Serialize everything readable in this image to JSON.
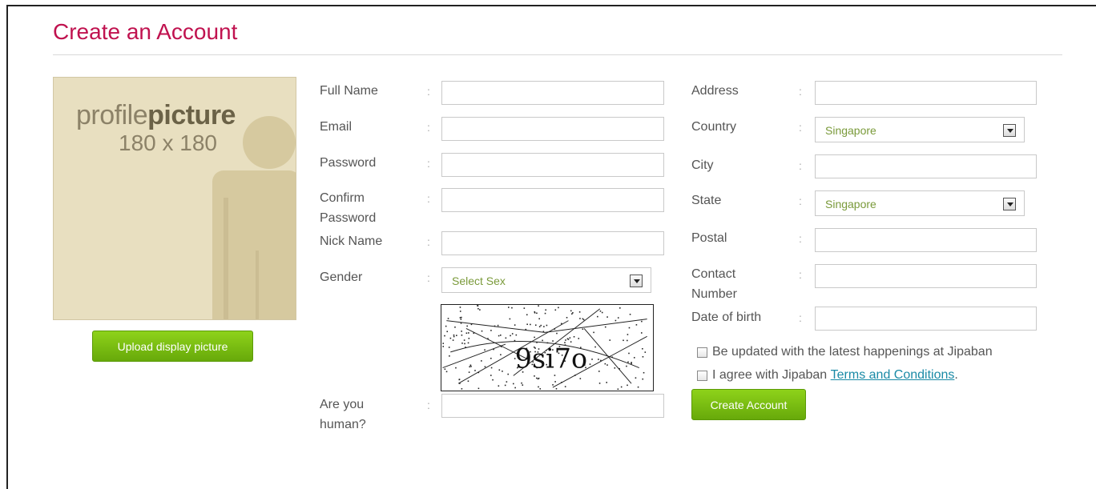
{
  "page": {
    "title": "Create an Account"
  },
  "profile": {
    "label_light": "profile",
    "label_bold": "picture",
    "size_label": "180 x 180",
    "upload_label": "Upload display picture"
  },
  "colon": ":",
  "left_form": {
    "full_name": {
      "label": "Full Name",
      "value": ""
    },
    "email": {
      "label": "Email",
      "value": ""
    },
    "password": {
      "label": "Password",
      "value": ""
    },
    "confirm_password": {
      "label_line1": "Confirm",
      "label_line2": "Password",
      "value": ""
    },
    "nick_name": {
      "label": "Nick Name",
      "value": ""
    },
    "gender": {
      "label": "Gender",
      "selected": "Select Sex"
    },
    "captcha": {
      "text": "9si7o"
    },
    "human": {
      "label_line1": "Are you",
      "label_line2": "human?",
      "value": ""
    }
  },
  "right_form": {
    "address": {
      "label": "Address",
      "value": ""
    },
    "country": {
      "label": "Country",
      "selected": "Singapore"
    },
    "city": {
      "label": "City",
      "value": ""
    },
    "state": {
      "label": "State",
      "selected": "Singapore"
    },
    "postal": {
      "label": "Postal",
      "value": ""
    },
    "contact": {
      "label_line1": "Contact",
      "label_line2": "Number",
      "value": ""
    },
    "dob": {
      "label": "Date of birth",
      "value": ""
    }
  },
  "checkboxes": {
    "updates": {
      "label": "Be updated with the latest happenings at Jipaban",
      "checked": false
    },
    "terms": {
      "prefix": "I agree with Jipaban ",
      "link": "Terms and Conditions",
      "suffix": ".",
      "checked": false
    }
  },
  "create_label": "Create Account",
  "colors": {
    "title": "#c0124f",
    "button": "#7cc011",
    "select_text": "#7a9a3a",
    "link": "#1a8aa6"
  }
}
